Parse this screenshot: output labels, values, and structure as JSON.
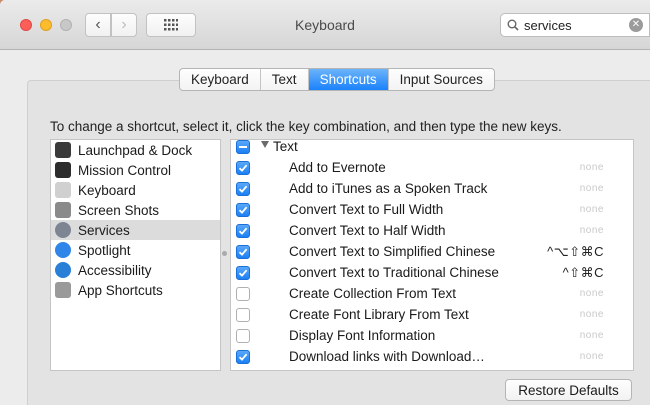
{
  "window": {
    "title": "Keyboard",
    "search_value": "services"
  },
  "tabs": [
    {
      "label": "Keyboard",
      "active": false
    },
    {
      "label": "Text",
      "active": false
    },
    {
      "label": "Shortcuts",
      "active": true
    },
    {
      "label": "Input Sources",
      "active": false
    }
  ],
  "instructions": "To change a shortcut, select it, click the key combination, and then type the new keys.",
  "categories": [
    {
      "label": "Launchpad & Dock",
      "icon": "launchpad-dock-icon",
      "color": "#3a3a3a",
      "selected": false
    },
    {
      "label": "Mission Control",
      "icon": "mission-control-icon",
      "color": "#2c2c2c",
      "selected": false
    },
    {
      "label": "Keyboard",
      "icon": "keyboard-icon",
      "color": "#d0d0d0",
      "selected": false
    },
    {
      "label": "Screen Shots",
      "icon": "screenshot-icon",
      "color": "#8a8a8a",
      "selected": false
    },
    {
      "label": "Services",
      "icon": "gear-icon",
      "color": "#7d8592",
      "selected": true
    },
    {
      "label": "Spotlight",
      "icon": "spotlight-icon",
      "color": "#2f86e8",
      "selected": false
    },
    {
      "label": "Accessibility",
      "icon": "accessibility-icon",
      "color": "#2a7fd6",
      "selected": false
    },
    {
      "label": "App Shortcuts",
      "icon": "app-shortcuts-icon",
      "color": "#9a9a9a",
      "selected": false
    }
  ],
  "group": {
    "label": "Text",
    "state": "mixed"
  },
  "services": [
    {
      "label": "Add to Evernote",
      "checked": true,
      "shortcut": "none"
    },
    {
      "label": "Add to iTunes as a Spoken Track",
      "checked": true,
      "shortcut": "none"
    },
    {
      "label": "Convert Text to Full Width",
      "checked": true,
      "shortcut": "none"
    },
    {
      "label": "Convert Text to Half Width",
      "checked": true,
      "shortcut": "none"
    },
    {
      "label": "Convert Text to Simplified Chinese",
      "checked": true,
      "shortcut": "^⌥⇧⌘C"
    },
    {
      "label": "Convert Text to Traditional Chinese",
      "checked": true,
      "shortcut": "^⇧⌘C"
    },
    {
      "label": "Create Collection From Text",
      "checked": false,
      "shortcut": "none"
    },
    {
      "label": "Create Font Library From Text",
      "checked": false,
      "shortcut": "none"
    },
    {
      "label": "Display Font Information",
      "checked": false,
      "shortcut": "none"
    },
    {
      "label": "Download links with Download…",
      "checked": true,
      "shortcut": "none"
    }
  ],
  "restore_label": "Restore Defaults",
  "colors": {
    "accent": "#1a82fb",
    "selection": "#dcdcdc"
  }
}
